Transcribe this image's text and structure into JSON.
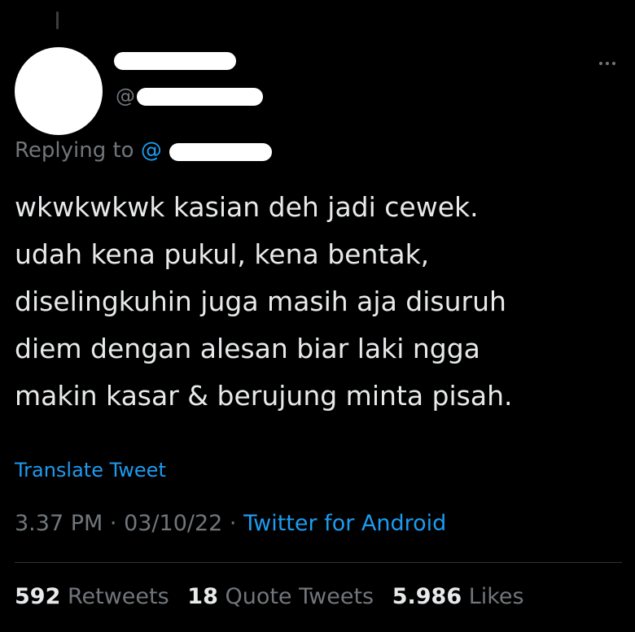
{
  "tweet": {
    "handle_prefix": "@",
    "replying_label": "Replying to",
    "replying_at": "@",
    "text": "wkwkwkwk kasian deh jadi cewek.\nudah kena pukul, kena bentak,\ndiselingkuhin juga masih aja disuruh\ndiem dengan alesan biar laki ngga\nmakin kasar & berujung minta pisah.",
    "translate_label": "Translate Tweet",
    "time": "3.37 PM",
    "date": "03/10/22",
    "separator": "·",
    "source": "Twitter for Android"
  },
  "stats": {
    "retweets_count": "592",
    "retweets_label": "Retweets",
    "quote_count": "18",
    "quote_label": "Quote Tweets",
    "likes_count": "5.986",
    "likes_label": "Likes"
  },
  "icons": {
    "more": "more-horizontal-icon"
  },
  "colors": {
    "background": "#000000",
    "text": "#e7e9ea",
    "secondary": "#71767b",
    "accent": "#1d9bf0",
    "divider": "#2f3336",
    "redaction": "#ffffff"
  }
}
